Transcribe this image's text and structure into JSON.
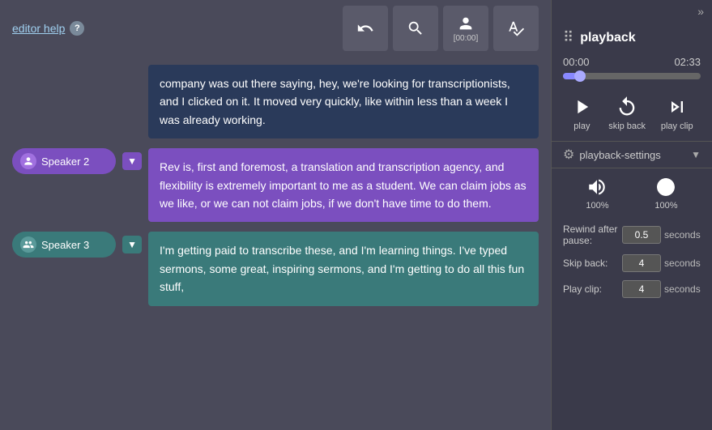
{
  "toolbar": {
    "editor_help_label": "editor help",
    "help_tooltip": "?",
    "undo_label": "",
    "search_label": "",
    "speaker_label": "[00:00]",
    "abc_label": ""
  },
  "speakers": [
    {
      "id": "speaker2",
      "label": "Speaker 2",
      "color": "purple",
      "text": "Rev is, first and foremost, a translation and transcription agency, and flexibility  is extremely important to me as a student. We can claim jobs as we like, or we can not claim jobs, if we don't have time to do them."
    },
    {
      "id": "speaker3",
      "label": "Speaker 3",
      "color": "teal",
      "text": "I'm getting paid to transcribe these, and I'm learning things. I've typed sermons, some great, inspiring sermons, and I'm getting to do all this fun stuff,"
    }
  ],
  "previous_text": "company was out there saying, hey, we're looking for transcriptionists, and I clicked on it. It moved very quickly, like within less than a week I was already working.",
  "playback": {
    "title": "playback",
    "current_time": "00:00",
    "total_time": "02:33",
    "progress_percent": 10,
    "play_label": "play",
    "skip_back_label": "skip back",
    "play_clip_label": "play clip",
    "settings_title": "playback-settings",
    "volume_label": "100%",
    "speed_label": "100%",
    "rewind_label": "Rewind after pause:",
    "rewind_value": "0.5",
    "rewind_unit": "seconds",
    "skip_back_label2": "Skip back:",
    "skip_back_value": "4",
    "skip_back_unit": "seconds",
    "play_clip_label2": "Play clip:",
    "play_clip_value": "4",
    "play_clip_unit": "seconds"
  }
}
